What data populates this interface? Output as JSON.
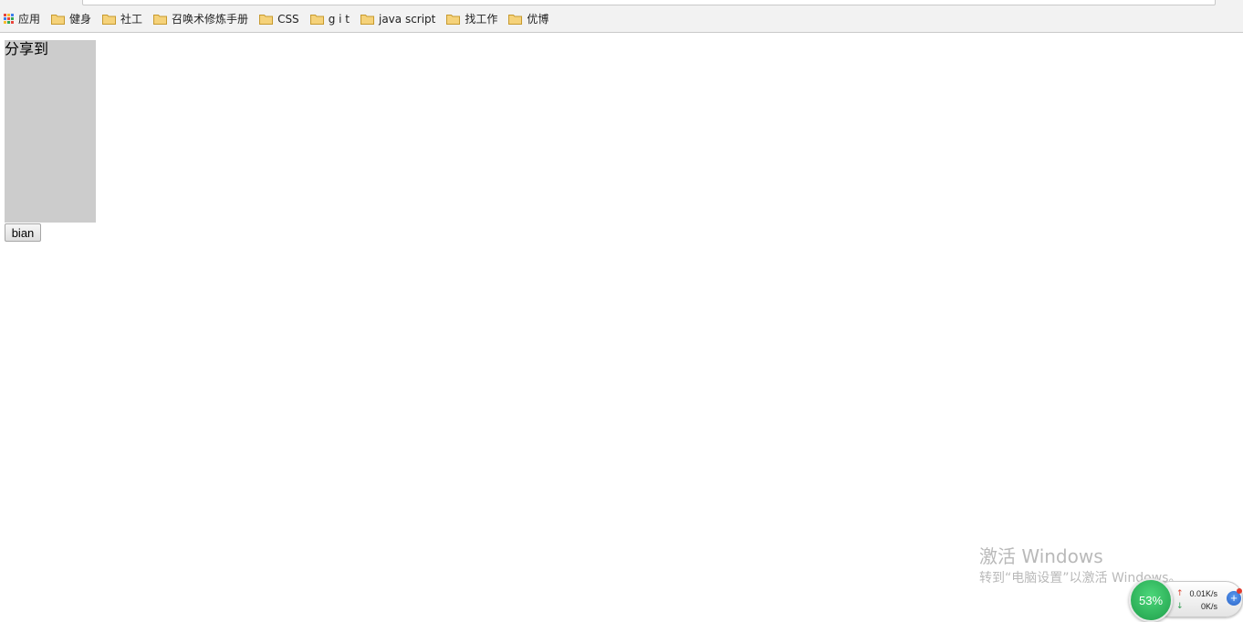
{
  "bookmarks": [
    {
      "label": "应用",
      "icon": "apps-icon"
    },
    {
      "label": "健身",
      "icon": "folder-icon"
    },
    {
      "label": "社工",
      "icon": "folder-icon"
    },
    {
      "label": "召唤术修炼手册",
      "icon": "folder-icon"
    },
    {
      "label": "CSS",
      "icon": "folder-icon"
    },
    {
      "label": "g i t",
      "icon": "folder-icon"
    },
    {
      "label": "java script",
      "icon": "folder-icon"
    },
    {
      "label": "找工作",
      "icon": "folder-icon"
    },
    {
      "label": "优博",
      "icon": "folder-icon"
    }
  ],
  "content": {
    "share_label": "分享到",
    "button_label": "bian"
  },
  "watermark": {
    "title": "激活 Windows",
    "subtitle": "转到“电脑设置”以激活 Windows。"
  },
  "speed_widget": {
    "percent": "53%",
    "upload": "0.01K/s",
    "download": "0K/s"
  },
  "colors": {
    "share_box_bg": "#cccccc",
    "bookmarks_bar_bg": "#f2f2f2",
    "folder": "#f5c85a",
    "speed_circle": "#2fb35c"
  }
}
